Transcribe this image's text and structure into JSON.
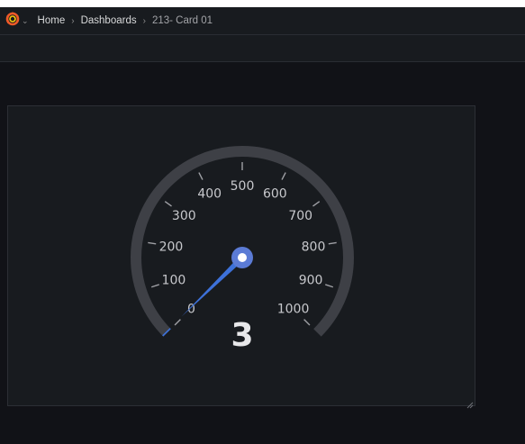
{
  "breadcrumb": {
    "home": "Home",
    "dashboards": "Dashboards",
    "current": "213- Card 01"
  },
  "icons": {
    "logo": "grafana-logo-icon",
    "logo_menu": "chevron-down-icon",
    "separator": "chevron-right-icon",
    "resize": "resize-handle-icon"
  },
  "colors": {
    "accent": "#5b7bd5",
    "needle": "#3d71d9",
    "track": "#3e4046",
    "brand_orange": "#f05a28"
  },
  "gauge": {
    "value": 3,
    "value_text": "3",
    "min": 0,
    "max": 1000,
    "ticks": [
      "0",
      "100",
      "200",
      "300",
      "400",
      "500",
      "600",
      "700",
      "800",
      "900",
      "1000"
    ]
  }
}
